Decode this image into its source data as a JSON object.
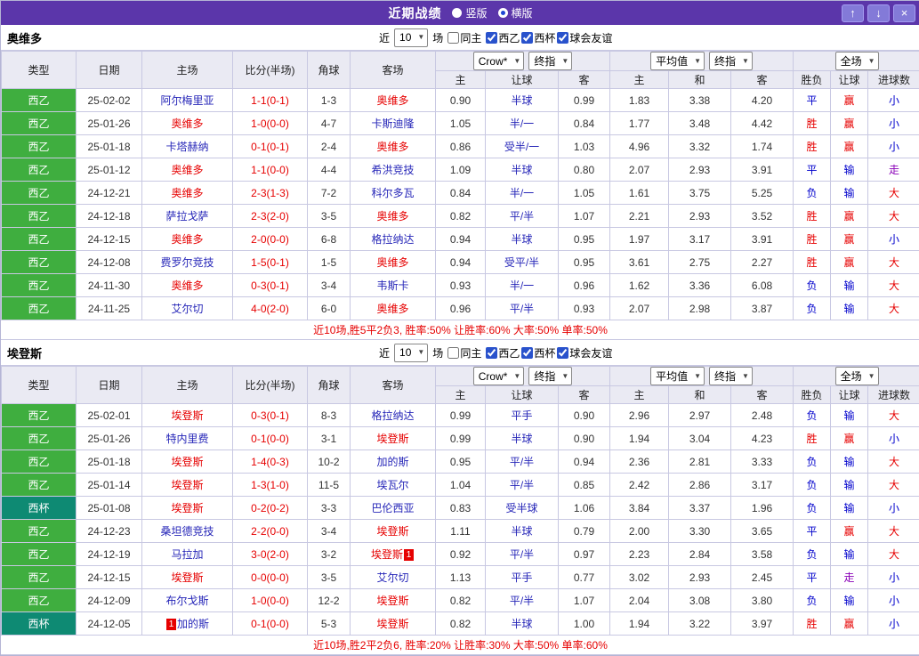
{
  "titlebar": {
    "title": "近期战绩",
    "radio_vertical": "竖版",
    "radio_horizontal": "横版",
    "up_icon": "↑",
    "down_icon": "↓",
    "close_icon": "×"
  },
  "controls": {
    "near_label": "近",
    "rounds_value": "10",
    "rounds_suffix": "场",
    "same_home": {
      "label": "同主",
      "checked": false
    },
    "league_filters": [
      {
        "label": "西乙",
        "checked": true
      },
      {
        "label": "西杯",
        "checked": true
      },
      {
        "label": "球会友谊",
        "checked": true
      }
    ]
  },
  "table_header": {
    "cols": [
      "类型",
      "日期",
      "主场",
      "比分(半场)",
      "角球",
      "客场"
    ],
    "odds_group": {
      "dd1": "Crow*",
      "dd2": "终指"
    },
    "odds_sub": [
      "主",
      "让球",
      "客"
    ],
    "euro_group": {
      "dd1": "平均值",
      "dd2": "终指"
    },
    "euro_sub": [
      "主",
      "和",
      "客"
    ],
    "result_group": {
      "dd1": "全场"
    },
    "result_sub": [
      "胜负",
      "让球",
      "进球数"
    ]
  },
  "colors": {
    "titlebar_purple": "#5b36aa",
    "league_badge_green": "#3fae3f",
    "cup_badge_teal": "#0e8a73",
    "win_red": "#e60000",
    "loss_blue": "#0000cc",
    "push_purple": "#8a00b8",
    "link_blue": "#2626b8",
    "header_bg": "#eaeaf3"
  },
  "sections": [
    {
      "team": "奥维多",
      "summary": "近10场,胜5平2负3, 胜率:50% 让胜率:60% 大率:50% 单率:50%",
      "rows": [
        {
          "league": "西乙",
          "cup": false,
          "date": "25-02-02",
          "home": {
            "name": "阿尔梅里亚",
            "focus": false
          },
          "score": "1-1(0-1)",
          "corner": "1-3",
          "away": {
            "name": "奥维多",
            "focus": true
          },
          "asia": [
            "0.90",
            "半球",
            "0.99"
          ],
          "euro": [
            "1.83",
            "3.38",
            "4.20"
          ],
          "results": [
            "平",
            "赢",
            "小"
          ]
        },
        {
          "league": "西乙",
          "cup": false,
          "date": "25-01-26",
          "home": {
            "name": "奥维多",
            "focus": true
          },
          "score": "1-0(0-0)",
          "corner": "4-7",
          "away": {
            "name": "卡斯迪隆",
            "focus": false
          },
          "asia": [
            "1.05",
            "半/一",
            "0.84"
          ],
          "euro": [
            "1.77",
            "3.48",
            "4.42"
          ],
          "results": [
            "胜",
            "赢",
            "小"
          ]
        },
        {
          "league": "西乙",
          "cup": false,
          "date": "25-01-18",
          "home": {
            "name": "卡塔赫纳",
            "focus": false
          },
          "score": "0-1(0-1)",
          "corner": "2-4",
          "away": {
            "name": "奥维多",
            "focus": true
          },
          "asia": [
            "0.86",
            "受半/一",
            "1.03"
          ],
          "euro": [
            "4.96",
            "3.32",
            "1.74"
          ],
          "results": [
            "胜",
            "赢",
            "小"
          ]
        },
        {
          "league": "西乙",
          "cup": false,
          "date": "25-01-12",
          "home": {
            "name": "奥维多",
            "focus": true
          },
          "score": "1-1(0-0)",
          "corner": "4-4",
          "away": {
            "name": "希洪竞技",
            "focus": false
          },
          "asia": [
            "1.09",
            "半球",
            "0.80"
          ],
          "euro": [
            "2.07",
            "2.93",
            "3.91"
          ],
          "results": [
            "平",
            "输",
            "走"
          ]
        },
        {
          "league": "西乙",
          "cup": false,
          "date": "24-12-21",
          "home": {
            "name": "奥维多",
            "focus": true
          },
          "score": "2-3(1-3)",
          "corner": "7-2",
          "away": {
            "name": "科尔多瓦",
            "focus": false
          },
          "asia": [
            "0.84",
            "半/一",
            "1.05"
          ],
          "euro": [
            "1.61",
            "3.75",
            "5.25"
          ],
          "results": [
            "负",
            "输",
            "大"
          ]
        },
        {
          "league": "西乙",
          "cup": false,
          "date": "24-12-18",
          "home": {
            "name": "萨拉戈萨",
            "focus": false
          },
          "score": "2-3(2-0)",
          "corner": "3-5",
          "away": {
            "name": "奥维多",
            "focus": true
          },
          "asia": [
            "0.82",
            "平/半",
            "1.07"
          ],
          "euro": [
            "2.21",
            "2.93",
            "3.52"
          ],
          "results": [
            "胜",
            "赢",
            "大"
          ]
        },
        {
          "league": "西乙",
          "cup": false,
          "date": "24-12-15",
          "home": {
            "name": "奥维多",
            "focus": true
          },
          "score": "2-0(0-0)",
          "corner": "6-8",
          "away": {
            "name": "格拉纳达",
            "focus": false
          },
          "asia": [
            "0.94",
            "半球",
            "0.95"
          ],
          "euro": [
            "1.97",
            "3.17",
            "3.91"
          ],
          "results": [
            "胜",
            "赢",
            "小"
          ]
        },
        {
          "league": "西乙",
          "cup": false,
          "date": "24-12-08",
          "home": {
            "name": "费罗尔竞技",
            "focus": false
          },
          "score": "1-5(0-1)",
          "corner": "1-5",
          "away": {
            "name": "奥维多",
            "focus": true
          },
          "asia": [
            "0.94",
            "受平/半",
            "0.95"
          ],
          "euro": [
            "3.61",
            "2.75",
            "2.27"
          ],
          "results": [
            "胜",
            "赢",
            "大"
          ]
        },
        {
          "league": "西乙",
          "cup": false,
          "date": "24-11-30",
          "home": {
            "name": "奥维多",
            "focus": true
          },
          "score": "0-3(0-1)",
          "corner": "3-4",
          "away": {
            "name": "韦斯卡",
            "focus": false
          },
          "asia": [
            "0.93",
            "半/一",
            "0.96"
          ],
          "euro": [
            "1.62",
            "3.36",
            "6.08"
          ],
          "results": [
            "负",
            "输",
            "大"
          ]
        },
        {
          "league": "西乙",
          "cup": false,
          "date": "24-11-25",
          "home": {
            "name": "艾尔切",
            "focus": false
          },
          "score": "4-0(2-0)",
          "corner": "6-0",
          "away": {
            "name": "奥维多",
            "focus": true
          },
          "asia": [
            "0.96",
            "平/半",
            "0.93"
          ],
          "euro": [
            "2.07",
            "2.98",
            "3.87"
          ],
          "results": [
            "负",
            "输",
            "大"
          ]
        }
      ]
    },
    {
      "team": "埃登斯",
      "summary": "近10场,胜2平2负6, 胜率:20% 让胜率:30% 大率:50% 单率:60%",
      "rows": [
        {
          "league": "西乙",
          "cup": false,
          "date": "25-02-01",
          "home": {
            "name": "埃登斯",
            "focus": true
          },
          "score": "0-3(0-1)",
          "corner": "8-3",
          "away": {
            "name": "格拉纳达",
            "focus": false
          },
          "asia": [
            "0.99",
            "平手",
            "0.90"
          ],
          "euro": [
            "2.96",
            "2.97",
            "2.48"
          ],
          "results": [
            "负",
            "输",
            "大"
          ]
        },
        {
          "league": "西乙",
          "cup": false,
          "date": "25-01-26",
          "home": {
            "name": "特内里费",
            "focus": false
          },
          "score": "0-1(0-0)",
          "corner": "3-1",
          "away": {
            "name": "埃登斯",
            "focus": true
          },
          "asia": [
            "0.99",
            "半球",
            "0.90"
          ],
          "euro": [
            "1.94",
            "3.04",
            "4.23"
          ],
          "results": [
            "胜",
            "赢",
            "小"
          ]
        },
        {
          "league": "西乙",
          "cup": false,
          "date": "25-01-18",
          "home": {
            "name": "埃登斯",
            "focus": true
          },
          "score": "1-4(0-3)",
          "corner": "10-2",
          "away": {
            "name": "加的斯",
            "focus": false
          },
          "asia": [
            "0.95",
            "平/半",
            "0.94"
          ],
          "euro": [
            "2.36",
            "2.81",
            "3.33"
          ],
          "results": [
            "负",
            "输",
            "大"
          ]
        },
        {
          "league": "西乙",
          "cup": false,
          "date": "25-01-14",
          "home": {
            "name": "埃登斯",
            "focus": true
          },
          "score": "1-3(1-0)",
          "corner": "11-5",
          "away": {
            "name": "埃瓦尔",
            "focus": false
          },
          "asia": [
            "1.04",
            "平/半",
            "0.85"
          ],
          "euro": [
            "2.42",
            "2.86",
            "3.17"
          ],
          "results": [
            "负",
            "输",
            "大"
          ]
        },
        {
          "league": "西杯",
          "cup": true,
          "date": "25-01-08",
          "home": {
            "name": "埃登斯",
            "focus": true
          },
          "score": "0-2(0-2)",
          "corner": "3-3",
          "away": {
            "name": "巴伦西亚",
            "focus": false
          },
          "asia": [
            "0.83",
            "受半球",
            "1.06"
          ],
          "euro": [
            "3.84",
            "3.37",
            "1.96"
          ],
          "results": [
            "负",
            "输",
            "小"
          ]
        },
        {
          "league": "西乙",
          "cup": false,
          "date": "24-12-23",
          "home": {
            "name": "桑坦德竞技",
            "focus": false
          },
          "score": "2-2(0-0)",
          "corner": "3-4",
          "away": {
            "name": "埃登斯",
            "focus": true
          },
          "asia": [
            "1.11",
            "半球",
            "0.79"
          ],
          "euro": [
            "2.00",
            "3.30",
            "3.65"
          ],
          "results": [
            "平",
            "赢",
            "大"
          ]
        },
        {
          "league": "西乙",
          "cup": false,
          "date": "24-12-19",
          "home": {
            "name": "马拉加",
            "focus": false
          },
          "score": "3-0(2-0)",
          "corner": "3-2",
          "away": {
            "name": "埃登斯",
            "focus": true,
            "card_after": "1"
          },
          "asia": [
            "0.92",
            "平/半",
            "0.97"
          ],
          "euro": [
            "2.23",
            "2.84",
            "3.58"
          ],
          "results": [
            "负",
            "输",
            "大"
          ]
        },
        {
          "league": "西乙",
          "cup": false,
          "date": "24-12-15",
          "home": {
            "name": "埃登斯",
            "focus": true
          },
          "score": "0-0(0-0)",
          "corner": "3-5",
          "away": {
            "name": "艾尔切",
            "focus": false
          },
          "asia": [
            "1.13",
            "平手",
            "0.77"
          ],
          "euro": [
            "3.02",
            "2.93",
            "2.45"
          ],
          "results": [
            "平",
            "走",
            "小"
          ]
        },
        {
          "league": "西乙",
          "cup": false,
          "date": "24-12-09",
          "home": {
            "name": "布尔戈斯",
            "focus": false
          },
          "score": "1-0(0-0)",
          "corner": "12-2",
          "away": {
            "name": "埃登斯",
            "focus": true
          },
          "asia": [
            "0.82",
            "平/半",
            "1.07"
          ],
          "euro": [
            "2.04",
            "3.08",
            "3.80"
          ],
          "results": [
            "负",
            "输",
            "小"
          ]
        },
        {
          "league": "西杯",
          "cup": true,
          "date": "24-12-05",
          "home": {
            "name": "加的斯",
            "focus": false,
            "card_before": "1"
          },
          "score": "0-1(0-0)",
          "corner": "5-3",
          "away": {
            "name": "埃登斯",
            "focus": true
          },
          "asia": [
            "0.82",
            "半球",
            "1.00"
          ],
          "euro": [
            "1.94",
            "3.22",
            "3.97"
          ],
          "results": [
            "胜",
            "赢",
            "小"
          ]
        }
      ]
    }
  ]
}
